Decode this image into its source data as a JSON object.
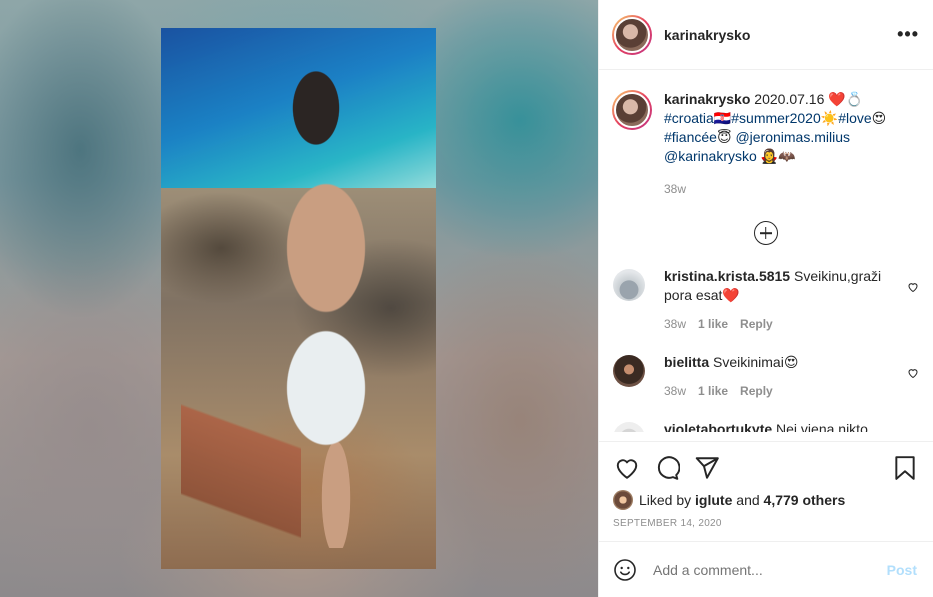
{
  "post": {
    "username": "karinakrysko",
    "more_icon": "more-horizontal-icon",
    "caption": {
      "date": "2020.07.16",
      "emoji1": "❤️💍",
      "tag1": "#croatia",
      "flag": "🇭🇷",
      "tag2": "#summer2020",
      "emoji2": "☀️",
      "tag3": "#love",
      "emoji3": "😍",
      "tag4": "#fiancée",
      "emoji4": "😇",
      "mention1": "@jeronimas.milius",
      "mention2": "@karinakrysko",
      "emoji5": "🧛‍♀️🦇",
      "age": "38w"
    },
    "comments": [
      {
        "username": "kristina.krista.5815",
        "text": "Sveikinu,graži pora esat",
        "emoji": "❤️",
        "age": "38w",
        "likes": "1 like",
        "reply": "Reply"
      },
      {
        "username": "bielitta",
        "text": "Sveikinimai",
        "emoji": "😍",
        "age": "38w",
        "likes": "1 like",
        "reply": "Reply"
      },
      {
        "username": "violetabortukyte",
        "text": "Nei viena nikto"
      }
    ],
    "liked_by_prefix": "Liked by",
    "liked_by_user": "iglute",
    "liked_by_and": "and",
    "liked_by_others": "4,779 others",
    "post_date": "September 14, 2020",
    "add_comment_placeholder": "Add a comment...",
    "post_button": "Post"
  }
}
